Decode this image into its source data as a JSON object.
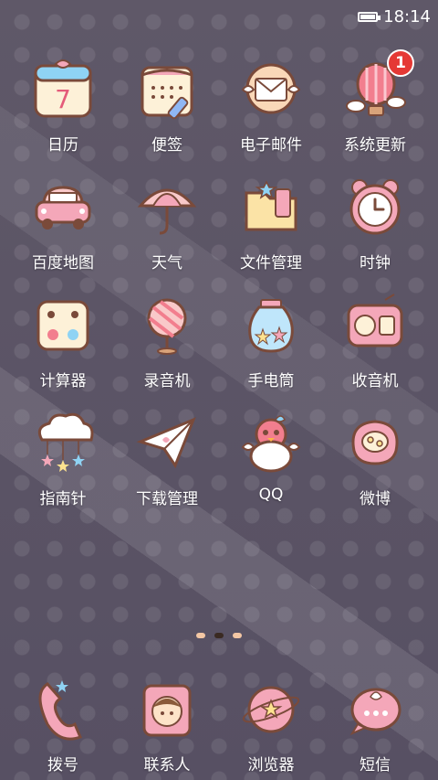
{
  "status_bar": {
    "time": "18:14"
  },
  "apps": [
    {
      "id": "calendar",
      "label": "日历",
      "icon": "calendar-icon"
    },
    {
      "id": "notes",
      "label": "便签",
      "icon": "notepad-icon"
    },
    {
      "id": "email",
      "label": "电子邮件",
      "icon": "envelope-icon"
    },
    {
      "id": "system-update",
      "label": "系统更新",
      "icon": "hot-air-balloon-icon",
      "badge": "1"
    },
    {
      "id": "map",
      "label": "百度地图",
      "icon": "car-icon"
    },
    {
      "id": "weather",
      "label": "天气",
      "icon": "umbrella-icon"
    },
    {
      "id": "file-manager",
      "label": "文件管理",
      "icon": "folder-icon"
    },
    {
      "id": "clock",
      "label": "时钟",
      "icon": "alarm-clock-icon"
    },
    {
      "id": "calculator",
      "label": "计算器",
      "icon": "dice-icon"
    },
    {
      "id": "recorder",
      "label": "录音机",
      "icon": "candy-icon"
    },
    {
      "id": "flashlight",
      "label": "手电筒",
      "icon": "star-jar-icon"
    },
    {
      "id": "radio",
      "label": "收音机",
      "icon": "radio-icon"
    },
    {
      "id": "compass",
      "label": "指南针",
      "icon": "cloud-stars-icon"
    },
    {
      "id": "download-manager",
      "label": "下载管理",
      "icon": "paper-plane-icon"
    },
    {
      "id": "qq",
      "label": "QQ",
      "icon": "penguin-icon"
    },
    {
      "id": "weibo",
      "label": "微博",
      "icon": "weibo-creature-icon"
    }
  ],
  "dock": [
    {
      "id": "dialer",
      "label": "拨号",
      "icon": "phone-receiver-icon"
    },
    {
      "id": "contacts",
      "label": "联系人",
      "icon": "contact-card-icon"
    },
    {
      "id": "browser",
      "label": "浏览器",
      "icon": "planet-icon"
    },
    {
      "id": "messages",
      "label": "短信",
      "icon": "speech-bubble-icon"
    }
  ],
  "calendar_day": "7",
  "colors": {
    "accent_pink": "#f4a7b9",
    "cream": "#fdf1d8",
    "badge_red": "#e53935",
    "outline": "#7a4a3a"
  }
}
